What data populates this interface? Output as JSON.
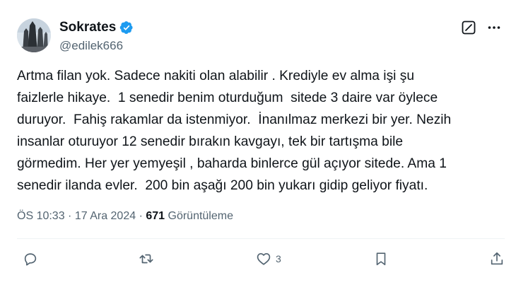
{
  "author": {
    "display_name": "Sokrates",
    "handle": "@edilek666",
    "verified": true,
    "avatar_icon": "avatar-image"
  },
  "tweet": {
    "text": "Artma filan yok. Sadece nakiti olan alabilir . Krediyle ev alma işi şu\nfaizlerle hikaye.  1 senedir benim oturduğum  sitede 3 daire var öylece\nduruyor.  Fahiş rakamlar da istenmiyor.  İnanılmaz merkezi bir yer. Nezih\ninsanlar oturuyor 12 senedir bırakın kavgayı, tek bir tartışma bile\ngörmedim. Her yer yemyeşil , baharda binlerce gül açıyor sitede. Ama 1\nsenedir ilanda evler.  200 bin aşağı 200 bin yukarı gidip geliyor fiyatı."
  },
  "meta": {
    "time": "ÖS 10:33",
    "separator": " · ",
    "date": "17 Ara 2024",
    "views_count": "671",
    "views_label": " Görüntüleme"
  },
  "actions": {
    "reply_count": "",
    "retweet_count": "",
    "like_count": "3"
  },
  "icons": {
    "verified": "verified-badge-icon",
    "grok": "grok-icon",
    "more": "more-icon",
    "reply": "reply-icon",
    "retweet": "retweet-icon",
    "like": "like-icon",
    "bookmark": "bookmark-icon",
    "share": "share-icon"
  },
  "colors": {
    "accent": "#1d9bf0",
    "text": "#0f1419",
    "secondary": "#536471"
  }
}
